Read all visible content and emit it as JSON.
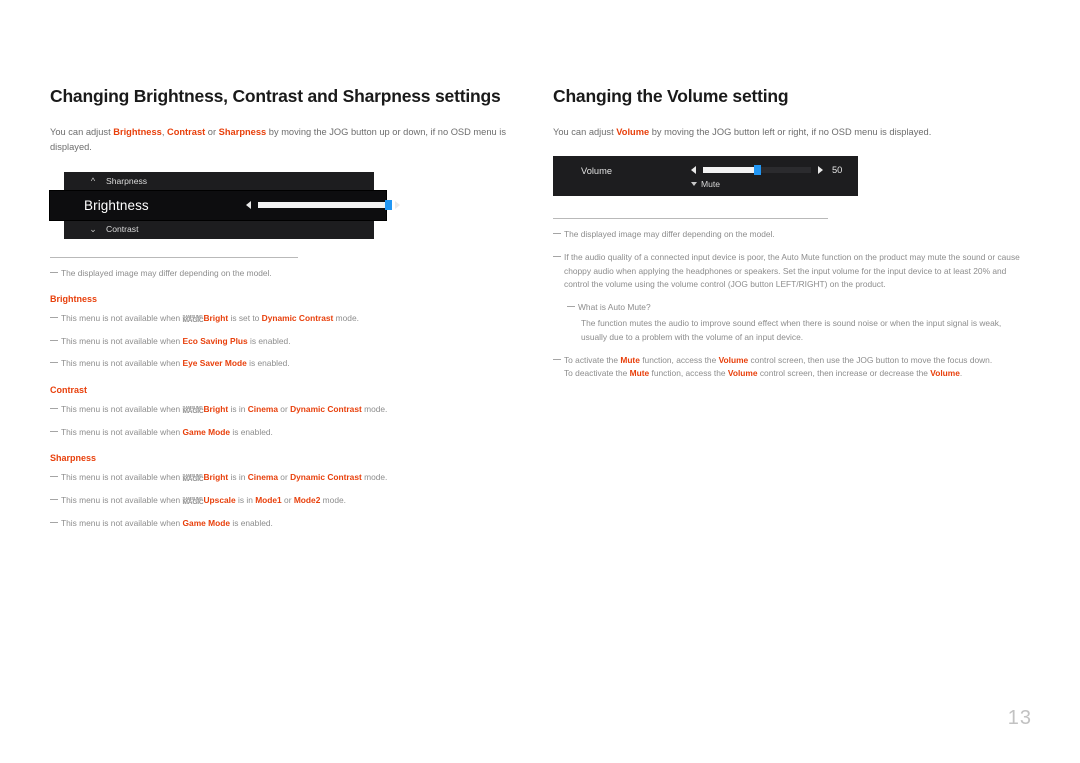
{
  "page": {
    "number": "13"
  },
  "left": {
    "title": "Changing Brightness, Contrast and Sharpness settings",
    "intro": {
      "p1": "You can adjust ",
      "hl1": "Brightness",
      "sep1": ", ",
      "hl2": "Contrast",
      "sep2": " or ",
      "hl3": "Sharpness",
      "p2": " by moving the JOG button up or down, if no OSD menu is displayed."
    },
    "osd": {
      "row_top_label": "Sharpness",
      "row_top_icon": "chevron-up-icon",
      "row_active_label": "Brightness",
      "row_active_value": "100",
      "row_active_fill_percent": 100,
      "row_bottom_label": "Contrast",
      "row_bottom_icon": "chevron-down-icon",
      "arrow_left_icon": "triangle-left-icon",
      "arrow_right_icon": "triangle-right-icon"
    },
    "note_model": "The displayed image may differ depending on the model.",
    "sections": [
      {
        "heading": "Brightness",
        "notes": [
          {
            "a": "This menu is not available when ",
            "magic": true,
            "magic_top": "SAMSUNG",
            "magic_bottom": "MAGIC",
            "b": "Bright",
            "c": " is set to ",
            "d": "Dynamic Contrast",
            "e": " mode."
          },
          {
            "a": "This menu is not available when ",
            "magic": false,
            "b": "Eco Saving Plus",
            "c": " is enabled.",
            "d": "",
            "e": ""
          },
          {
            "a": "This menu is not available when ",
            "magic": false,
            "b": "Eye Saver Mode",
            "c": " is enabled.",
            "d": "",
            "e": ""
          }
        ]
      },
      {
        "heading": "Contrast",
        "notes": [
          {
            "a": "This menu is not available when ",
            "magic": true,
            "magic_top": "SAMSUNG",
            "magic_bottom": "MAGIC",
            "b": "Bright",
            "c": " is in ",
            "d": "Cinema",
            "d2": " or ",
            "d3": "Dynamic Contrast",
            "e": " mode."
          },
          {
            "a": "This menu is not available when ",
            "magic": false,
            "b": "Game Mode",
            "c": " is enabled.",
            "d": "",
            "e": ""
          }
        ]
      },
      {
        "heading": "Sharpness",
        "notes": [
          {
            "a": "This menu is not available when ",
            "magic": true,
            "magic_top": "SAMSUNG",
            "magic_bottom": "MAGIC",
            "b": "Bright",
            "c": " is in ",
            "d": "Cinema",
            "d2": " or ",
            "d3": "Dynamic Contrast",
            "e": " mode."
          },
          {
            "a": "This menu is not available when ",
            "magic": true,
            "magic_top": "SAMSUNG",
            "magic_bottom": "MAGIC",
            "b": "Upscale",
            "c": " is in ",
            "d": "Mode1",
            "d2": " or ",
            "d3": "Mode2",
            "e": " mode."
          },
          {
            "a": "This menu is not available when ",
            "magic": false,
            "b": "Game Mode",
            "c": " is enabled.",
            "d": "",
            "e": ""
          }
        ]
      }
    ]
  },
  "right": {
    "title": "Changing the Volume setting",
    "intro": {
      "p1": "You can adjust ",
      "hl1": "Volume",
      "p2": " by moving the JOG button left or right, if no OSD menu is displayed."
    },
    "osd": {
      "volume_label": "Volume",
      "volume_value": "50",
      "volume_fill_percent": 50,
      "mute_label": "Mute",
      "mute_icon": "chevron-down-icon",
      "arrow_left_icon": "triangle-left-icon",
      "arrow_right_icon": "triangle-right-icon"
    },
    "note_model": "The displayed image may differ depending on the model.",
    "note_audio": "If the audio quality of a connected input device is poor, the Auto Mute function on the product may mute the sound or cause choppy audio when applying the headphones or speakers. Set the input volume for the input device to at least 20% and control the volume using the volume control (JOG button LEFT/RIGHT) on the product.",
    "note_whatis": "What is Auto Mute?",
    "note_whatis_body": "The function mutes the audio to improve sound effect when there is sound noise or when the input signal is weak, usually due to a problem with the volume of an input device.",
    "note_mute": {
      "l1_a": "To activate the ",
      "l1_b": "Mute",
      "l1_c": " function, access the ",
      "l1_d": "Volume",
      "l1_e": " control screen, then use the JOG button to move the focus down.",
      "l2_a": "To deactivate the ",
      "l2_b": "Mute",
      "l2_c": " function, access the ",
      "l2_d": "Volume",
      "l2_e": " control screen, then increase or decrease the ",
      "l2_f": "Volume",
      "l2_g": "."
    }
  }
}
